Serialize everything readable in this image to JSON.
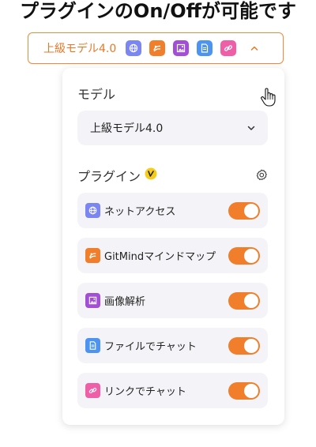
{
  "caption": "プラグインのOn/Offが可能です",
  "model_pill": {
    "label": "上級モデル4.0",
    "icons": [
      "globe-icon",
      "gitmind-icon",
      "image-icon",
      "document-icon",
      "link-icon"
    ],
    "chevron": "chevron-up-icon"
  },
  "panel": {
    "model_section_label": "モデル",
    "model_select": {
      "value": "上級モデル4.0",
      "chevron": "chevron-down-icon"
    },
    "plugin_section_label": "プラグイン",
    "plugin_badge_icon": "vip-badge-icon",
    "settings_icon": "gear-icon",
    "plugins": [
      {
        "label": "ネットアクセス",
        "icon": "globe-icon",
        "enabled": true
      },
      {
        "label": "GitMindマインドマップ",
        "icon": "gitmind-icon",
        "enabled": true
      },
      {
        "label": "画像解析",
        "icon": "image-icon",
        "enabled": true
      },
      {
        "label": "ファイルでチャット",
        "icon": "document-icon",
        "enabled": true
      },
      {
        "label": "リンクでチャット",
        "icon": "link-icon",
        "enabled": true
      }
    ]
  },
  "colors": {
    "accent": "#f07e2a",
    "pill_border": "#f08a3a",
    "row_background": "#f4f4f8",
    "globe": "#7b86f2",
    "gitmind": "#f07e2a",
    "image": "#a24fd6",
    "document": "#4d94f2",
    "link": "#ef5fa8",
    "badge": "#f6cc1c"
  }
}
